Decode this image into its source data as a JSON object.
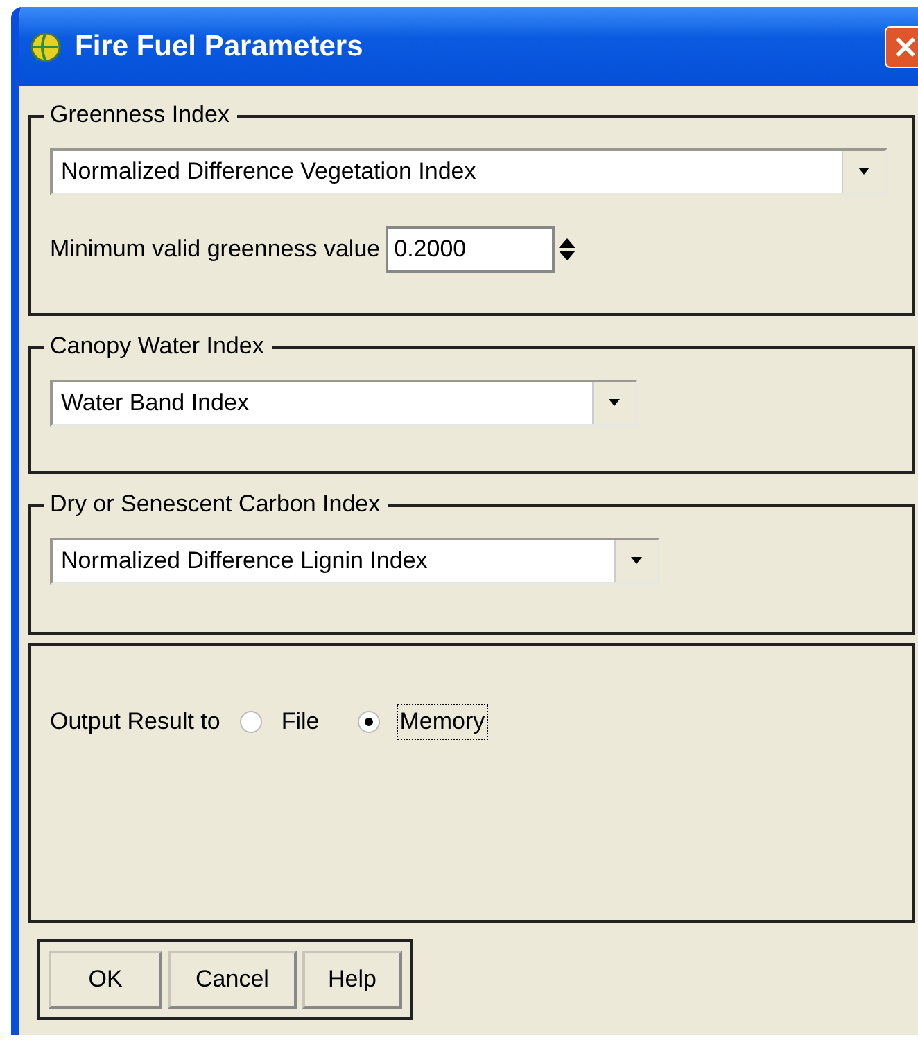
{
  "window": {
    "title": "Fire Fuel Parameters"
  },
  "greenness_index": {
    "title": "Greenness Index",
    "selection": "Normalized Difference Vegetation Index",
    "min_label": "Minimum valid greenness value",
    "min_value": "0.2000"
  },
  "canopy_water_index": {
    "title": "Canopy Water Index",
    "selection": "Water Band Index"
  },
  "carbon_index": {
    "title": "Dry or Senescent Carbon Index",
    "selection": "Normalized Difference Lignin Index"
  },
  "output": {
    "label": "Output Result to",
    "options": [
      {
        "label": "File",
        "selected": false
      },
      {
        "label": "Memory",
        "selected": true
      }
    ]
  },
  "buttons": [
    "OK",
    "Cancel",
    "Help"
  ]
}
